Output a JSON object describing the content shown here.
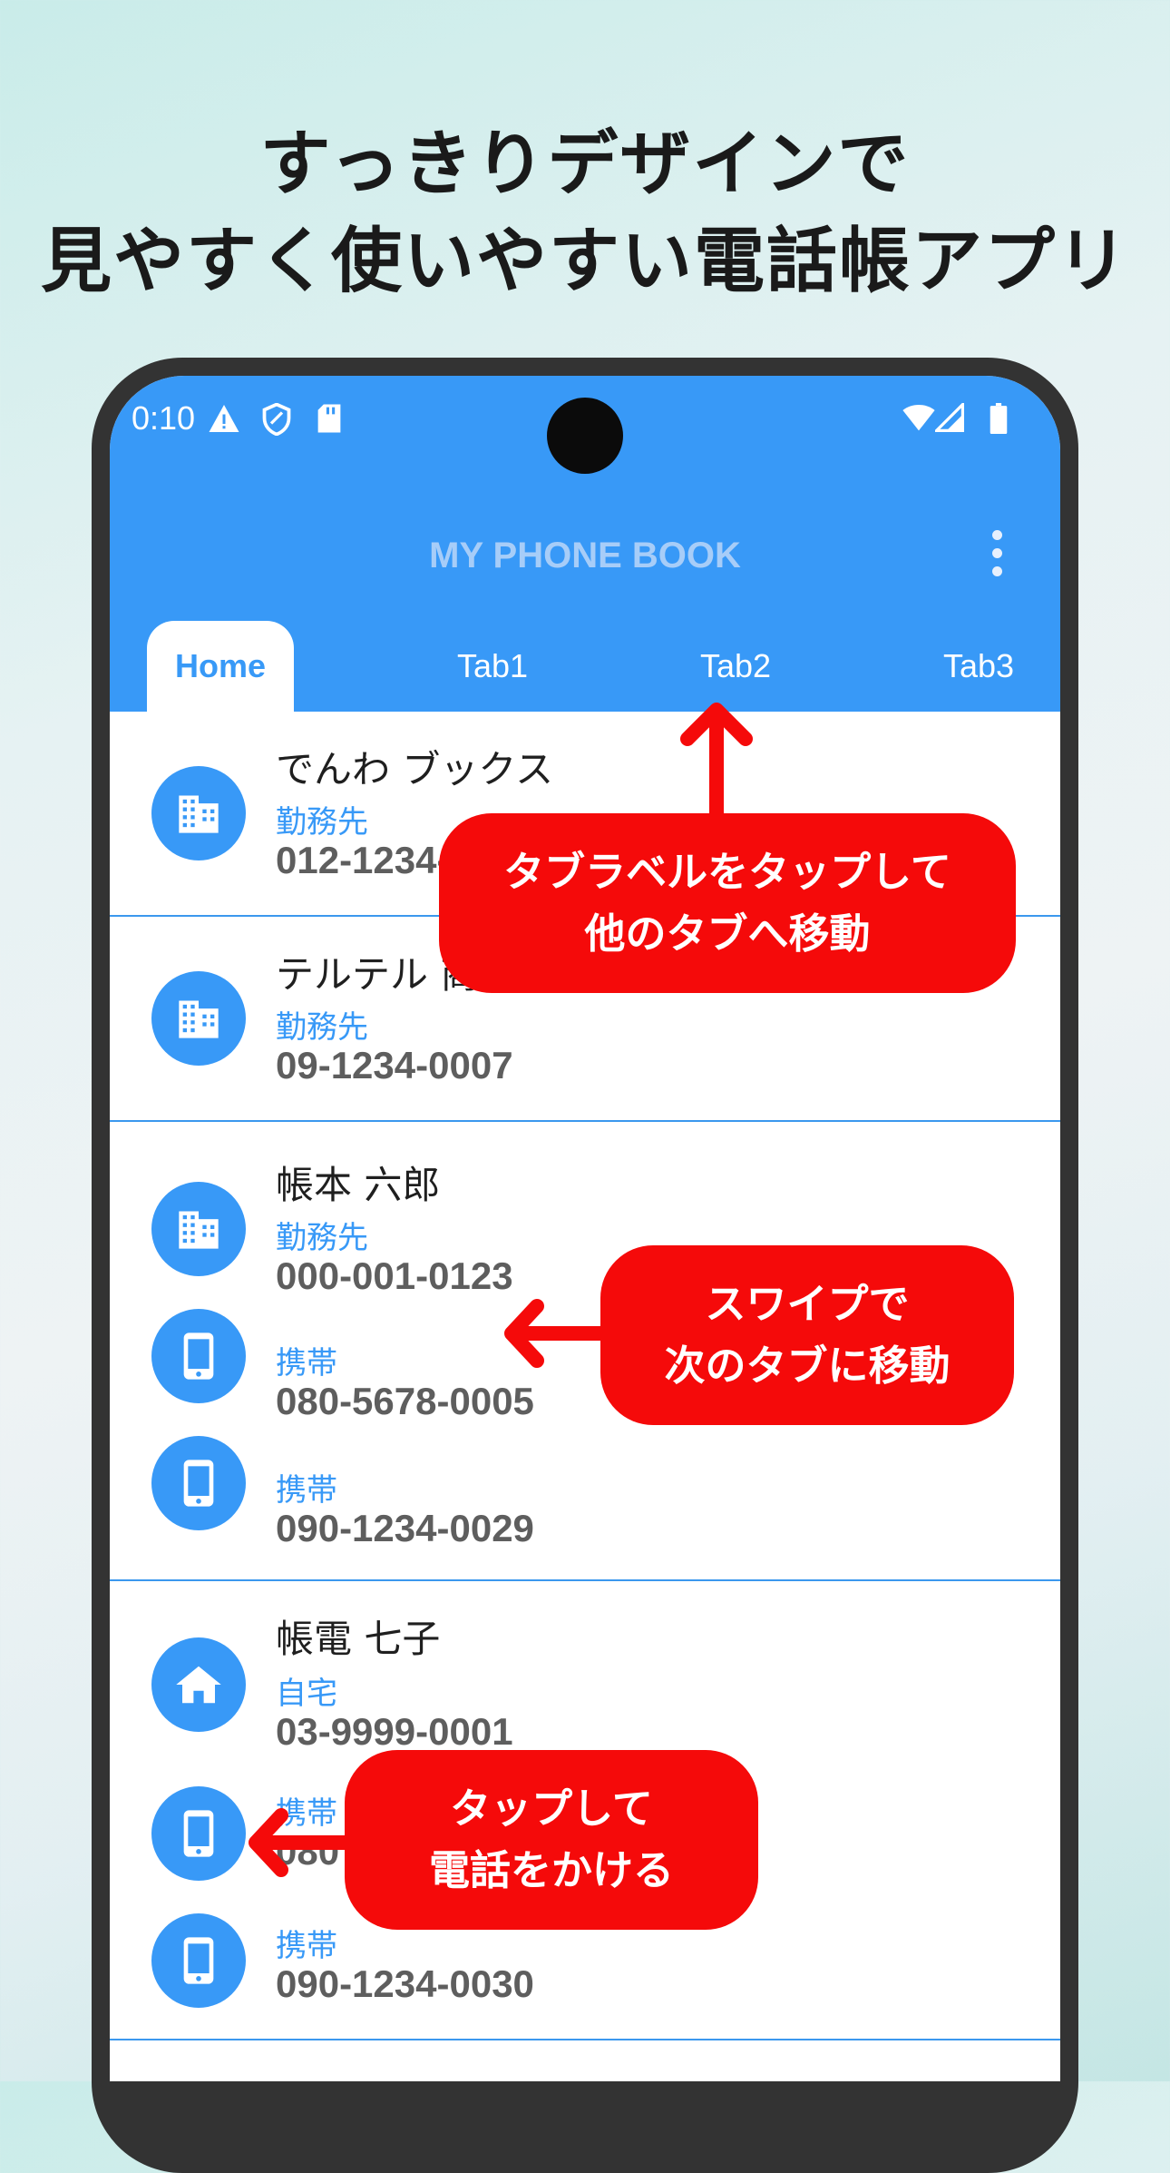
{
  "headline": {
    "line1": "すっきりデザインで",
    "line2": "見やすく使いやすい電話帳アプリ"
  },
  "status_bar": {
    "time": "0:10",
    "icons_left": [
      "warning-icon",
      "shield-icon",
      "sd-card-icon"
    ],
    "icons_right": [
      "wifi-icon",
      "signal-icon",
      "battery-icon"
    ]
  },
  "app_bar": {
    "title": "MY PHONE BOOK",
    "menu_icon": "more-vert-icon"
  },
  "tabs": [
    {
      "label": "Home",
      "active": true
    },
    {
      "label": "Tab1",
      "active": false
    },
    {
      "label": "Tab2",
      "active": false
    },
    {
      "label": "Tab3",
      "active": false
    }
  ],
  "contacts": [
    {
      "name": "でんわ ブックス",
      "phones": [
        {
          "icon": "building-icon",
          "type": "勤務先",
          "number": "012-1234-"
        }
      ]
    },
    {
      "name": "テルテル 商",
      "phones": [
        {
          "icon": "building-icon",
          "type": "勤務先",
          "number": "09-1234-0007"
        }
      ]
    },
    {
      "name": "帳本 六郎",
      "phones": [
        {
          "icon": "building-icon",
          "type": "勤務先",
          "number": "000-001-0123"
        },
        {
          "icon": "smartphone-icon",
          "type": "携帯",
          "number": "080-5678-0005"
        },
        {
          "icon": "smartphone-icon",
          "type": "携帯",
          "number": "090-1234-0029"
        }
      ]
    },
    {
      "name": "帳電 七子",
      "phones": [
        {
          "icon": "home-icon",
          "type": "自宅",
          "number": "03-9999-0001"
        },
        {
          "icon": "smartphone-icon",
          "type": "携帯",
          "number": "080"
        },
        {
          "icon": "smartphone-icon",
          "type": "携帯",
          "number": "090-1234-0030"
        }
      ]
    }
  ],
  "callouts": {
    "tab": {
      "line1": "タブラベルをタップして",
      "line2": "他のタブへ移動"
    },
    "swipe": {
      "line1": "スワイプで",
      "line2": "次のタブに移動"
    },
    "call": {
      "line1": "タップして",
      "line2": "電話をかける"
    }
  },
  "colors": {
    "primary": "#3899f7",
    "callout": "#f50a0a",
    "frame": "#333333"
  }
}
